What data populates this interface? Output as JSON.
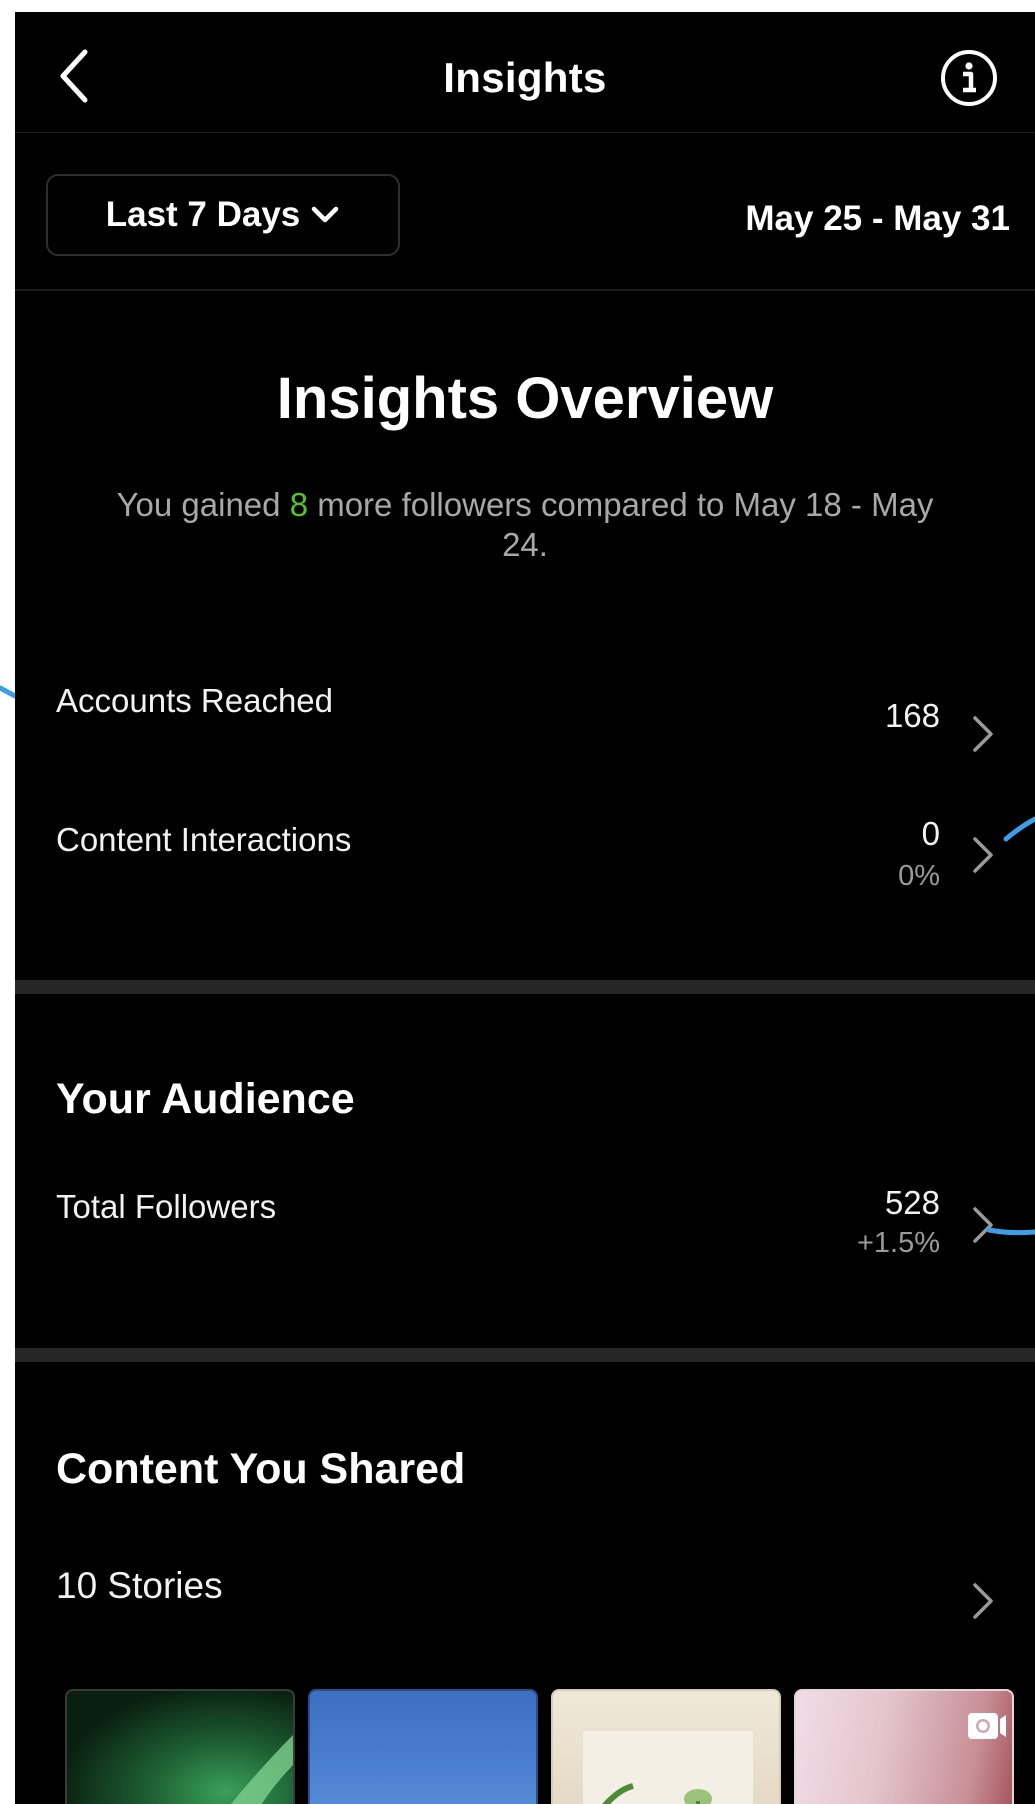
{
  "header": {
    "title": "Insights",
    "back_icon": "chevron-left-icon",
    "info_icon": "info-circle-icon"
  },
  "filter": {
    "period_label": "Last 7 Days",
    "date_range": "May 25 - May 31"
  },
  "overview": {
    "title": "Insights Overview",
    "subtitle_prefix": "You gained ",
    "subtitle_highlight": "8",
    "subtitle_suffix": " more followers compared to May 18 - May 24.",
    "metrics": [
      {
        "label": "Accounts Reached",
        "value": "168"
      },
      {
        "label": "Content Interactions",
        "value": "0",
        "change": "0%"
      }
    ]
  },
  "audience": {
    "title": "Your Audience",
    "total_followers_label": "Total Followers",
    "total_followers_value": "528",
    "total_followers_change": "+1.5%"
  },
  "content": {
    "title": "Content You Shared",
    "stories_label": "10 Stories"
  },
  "colors": {
    "background": "#000000",
    "positive": "#58c322",
    "muted_text": "#a8a8a8",
    "annotation_line": "#3a9ee8"
  }
}
